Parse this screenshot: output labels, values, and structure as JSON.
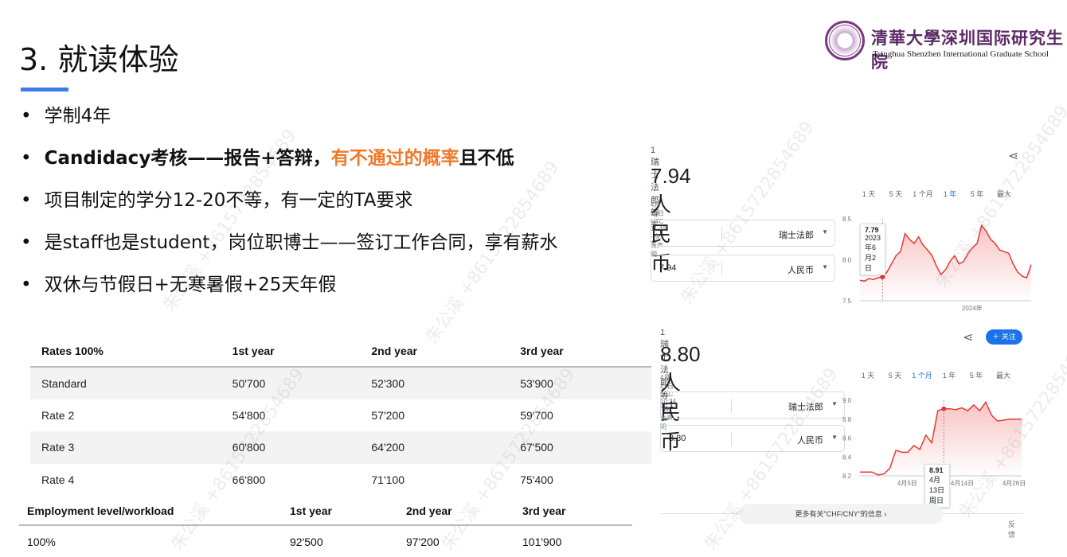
{
  "slide": {
    "title": "3. 就读体验",
    "watermark": "朱公溪 +8615722854689"
  },
  "logo": {
    "cn": "清華大學深圳国际研究生院",
    "en": "Tsinghua Shenzhen International Graduate School"
  },
  "bullets": [
    "学制4年",
    {
      "a": "Candidacy考核——报告+答辩，",
      "b": "有不通过的概率",
      "c": "且不低"
    },
    "项目制定的学分12-20不等，有一定的TA要求",
    "是staff也是student，岗位职博士——签订工作合同，享有薪水",
    "双休与节假日+无寒暑假+25天年假"
  ],
  "rates_table": {
    "headers": [
      "Rates 100%",
      "1st year",
      "2nd year",
      "3rd year"
    ],
    "rows": [
      [
        "Standard",
        "50'700",
        "52'300",
        "53'900"
      ],
      [
        "Rate 2",
        "54'800",
        "57'200",
        "59'700"
      ],
      [
        "Rate 3",
        "60'800",
        "64'200",
        "67'500"
      ],
      [
        "Rate 4",
        "66'800",
        "71'100",
        "75'400"
      ]
    ]
  },
  "employment_table": {
    "headers": [
      "Employment level/workload",
      "1st year",
      "2nd year",
      "3rd year"
    ],
    "rows": [
      [
        "100%",
        "92'500",
        "97'200",
        "101'900"
      ]
    ]
  },
  "converter1": {
    "label": "1 瑞士法郎 等于",
    "value": "7.94 人民币",
    "meta": "4月22日 UTC 11:46 · 免责声明",
    "from_amount": "1",
    "from_unit": "瑞士法郎",
    "to_amount": "7.94",
    "to_unit": "人民币",
    "ranges": [
      "1 天",
      "5 天",
      "1 个月",
      "1 年",
      "5 年",
      "最大"
    ],
    "active_range": "1 年",
    "tooltip": {
      "value": "7.79",
      "date": "2023年6月2日"
    }
  },
  "converter2": {
    "label": "1 瑞士法郎 等于",
    "value": "8.80 人民币",
    "meta": "4月27日 UTC 10:34 · 免责声明",
    "from_amount": "1",
    "from_unit": "瑞士法郎",
    "to_amount": "8.80",
    "to_unit": "人民币",
    "follow": "＋ 关注",
    "ranges": [
      "1 天",
      "5 天",
      "1 个月",
      "1 年",
      "5 年",
      "最大"
    ],
    "active_range": "1 个月",
    "tooltip": {
      "value": "8.91",
      "date": "4月13日周日"
    },
    "more_info": "更多有关\"CHF/CNY\"的信息  ›",
    "feedback": "反馈"
  },
  "colors": {
    "line": "#e53935",
    "accent": "#1a73e8",
    "orange": "#ee7a2a"
  },
  "chart_data": [
    {
      "type": "area",
      "title": "CHF/CNY 1年",
      "ylim": [
        7.5,
        8.5
      ],
      "yticks": [
        "8.5",
        "8.0",
        "7.5"
      ],
      "xticks": [
        "2024年"
      ],
      "values": [
        7.75,
        7.74,
        7.77,
        7.76,
        7.78,
        7.79,
        7.85,
        7.95,
        8.05,
        8.1,
        8.32,
        8.25,
        8.2,
        8.28,
        8.18,
        8.12,
        8.05,
        7.92,
        7.82,
        7.88,
        7.98,
        8.05,
        7.95,
        7.98,
        8.08,
        8.15,
        8.2,
        8.42,
        8.35,
        8.25,
        8.2,
        8.12,
        8.1,
        8.08,
        7.95,
        7.85,
        7.8,
        7.78,
        7.94
      ]
    },
    {
      "type": "area",
      "title": "CHF/CNY 1个月",
      "ylim": [
        8.2,
        9.0
      ],
      "yticks": [
        "9.0",
        "8.8",
        "8.6",
        "8.4",
        "8.2"
      ],
      "xticks": [
        "4月5日",
        "4月14日",
        "4月26日"
      ],
      "values": [
        8.24,
        8.24,
        8.24,
        8.21,
        8.22,
        8.28,
        8.47,
        8.45,
        8.45,
        8.52,
        8.48,
        8.63,
        8.55,
        8.89,
        8.91,
        8.91,
        8.9,
        8.92,
        8.89,
        8.95,
        8.89,
        8.98,
        8.84,
        8.78,
        8.79,
        8.8,
        8.8,
        8.8
      ]
    }
  ]
}
